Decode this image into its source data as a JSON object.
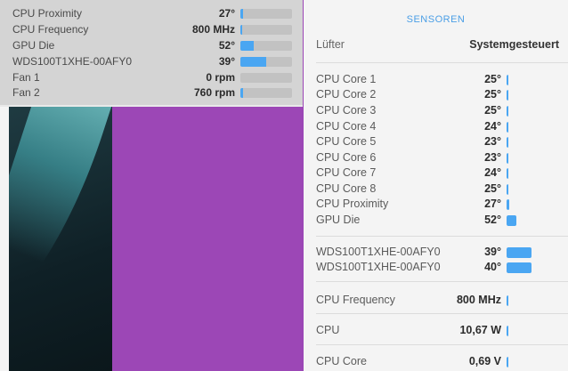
{
  "left_panel": {
    "rows": [
      {
        "name": "CPU Proximity",
        "value": "27°",
        "level": 0.05
      },
      {
        "name": "CPU Frequency",
        "value": "800 MHz",
        "level": 0.03
      },
      {
        "name": "GPU Die",
        "value": "52°",
        "level": 0.25
      },
      {
        "name": "WDS100T1XHE-00AFY0",
        "value": "39°",
        "level": 0.5
      },
      {
        "name": "Fan 1",
        "value": "0 rpm",
        "level": 0.0
      },
      {
        "name": "Fan 2",
        "value": "760 rpm",
        "level": 0.05
      }
    ]
  },
  "right_panel": {
    "title": "SENSOREN",
    "fan_label": "Lüfter",
    "fan_value": "Systemgesteuert",
    "core_rows": [
      {
        "name": "CPU Core 1",
        "value": "25°",
        "level": 0.04
      },
      {
        "name": "CPU Core 2",
        "value": "25°",
        "level": 0.04
      },
      {
        "name": "CPU Core 3",
        "value": "25°",
        "level": 0.04
      },
      {
        "name": "CPU Core 4",
        "value": "24°",
        "level": 0.04
      },
      {
        "name": "CPU Core 5",
        "value": "23°",
        "level": 0.04
      },
      {
        "name": "CPU Core 6",
        "value": "23°",
        "level": 0.04
      },
      {
        "name": "CPU Core 7",
        "value": "24°",
        "level": 0.04
      },
      {
        "name": "CPU Core 8",
        "value": "25°",
        "level": 0.04
      },
      {
        "name": "CPU Proximity",
        "value": "27°",
        "level": 0.05
      },
      {
        "name": "GPU Die",
        "value": "52°",
        "level": 0.2
      }
    ],
    "disk_rows": [
      {
        "name": "WDS100T1XHE-00AFY0",
        "value": "39°",
        "level": 0.5
      },
      {
        "name": "WDS100T1XHE-00AFY0",
        "value": "40°",
        "level": 0.5
      }
    ],
    "freq_row": {
      "name": "CPU Frequency",
      "value": "800 MHz",
      "level": 0.03
    },
    "power_row": {
      "name": "CPU",
      "value": "10,67 W",
      "level": 0.03
    },
    "voltage_row": {
      "name": "CPU Core",
      "value": "0,69 V",
      "level": 0.03
    }
  },
  "colors": {
    "accent": "#4aa6f2",
    "desktop": "#9c47b6"
  }
}
